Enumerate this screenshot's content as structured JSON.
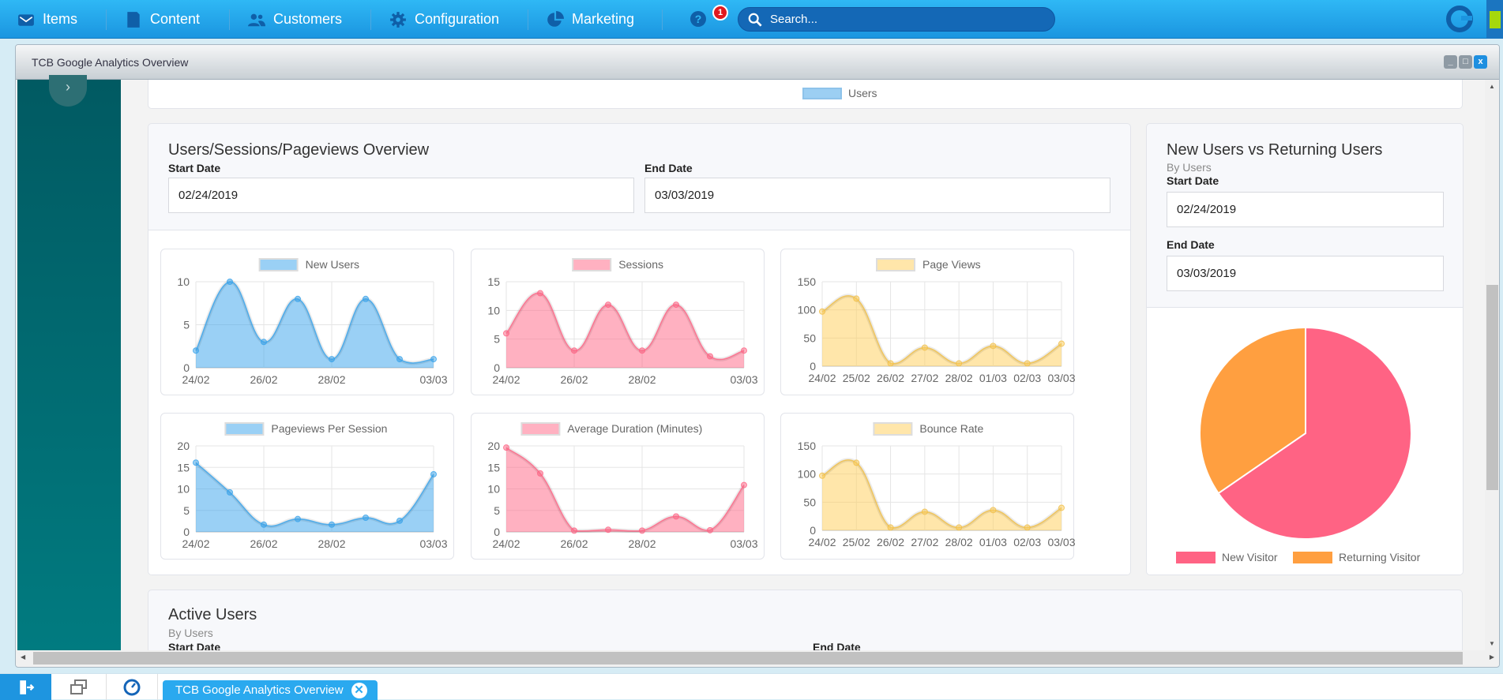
{
  "topnav": {
    "items": [
      {
        "label": "Items",
        "icon": "inbox-icon"
      },
      {
        "label": "Content",
        "icon": "document-icon"
      },
      {
        "label": "Customers",
        "icon": "users-icon"
      },
      {
        "label": "Configuration",
        "icon": "gear-icon"
      },
      {
        "label": "Marketing",
        "icon": "pie-chart-icon"
      }
    ],
    "help_badge": "1",
    "help_icon": "?",
    "search_placeholder": "Search..."
  },
  "window": {
    "title": "TCB Google Analytics Overview",
    "controls": {
      "minimize": "_",
      "maximize": "□",
      "close": "x"
    }
  },
  "users_card": {
    "legend": "Users"
  },
  "overview": {
    "title": "Users/Sessions/Pageviews Overview",
    "start_label": "Start Date",
    "start_value": "02/24/2019",
    "end_label": "End Date",
    "end_value": "03/03/2019"
  },
  "returning": {
    "title": "New Users vs Returning Users",
    "subtitle": "By Users",
    "start_label": "Start Date",
    "start_value": "02/24/2019",
    "end_label": "End Date",
    "end_value": "03/03/2019"
  },
  "active": {
    "title": "Active Users",
    "subtitle": "By Users",
    "start_label": "Start Date",
    "end_label": "End Date"
  },
  "colors": {
    "blue": "#36a2eb",
    "pink": "#ff6384",
    "yellow": "#ffce56",
    "orange": "#ff9f40"
  },
  "chart_data": [
    {
      "type": "area",
      "title": "New Users",
      "color": "blue",
      "categories": [
        "24/02",
        "25/02",
        "26/02",
        "27/02",
        "28/02",
        "01/03",
        "02/03",
        "03/03"
      ],
      "visible_ticks": [
        "24/02",
        "26/02",
        "28/02",
        "03/03"
      ],
      "values": [
        2,
        10,
        3,
        8,
        1,
        8,
        1,
        1
      ],
      "ylim": [
        0,
        10
      ],
      "yticks": [
        0,
        5,
        10
      ]
    },
    {
      "type": "area",
      "title": "Sessions",
      "color": "pink",
      "categories": [
        "24/02",
        "25/02",
        "26/02",
        "27/02",
        "28/02",
        "01/03",
        "02/03",
        "03/03"
      ],
      "visible_ticks": [
        "24/02",
        "26/02",
        "28/02",
        "03/03"
      ],
      "values": [
        6,
        13,
        3,
        11,
        3,
        11,
        2,
        3
      ],
      "ylim": [
        0,
        15
      ],
      "yticks": [
        0,
        5,
        10,
        15
      ]
    },
    {
      "type": "area",
      "title": "Page Views",
      "color": "yellow",
      "categories": [
        "24/02",
        "25/02",
        "26/02",
        "27/02",
        "28/02",
        "01/03",
        "02/03",
        "03/03"
      ],
      "visible_ticks": [
        "24/02",
        "25/02",
        "26/02",
        "27/02",
        "28/02",
        "01/03",
        "02/03",
        "03/03"
      ],
      "values": [
        97,
        120,
        5,
        33,
        5,
        36,
        5,
        40
      ],
      "ylim": [
        0,
        150
      ],
      "yticks": [
        0,
        50,
        100,
        150
      ]
    },
    {
      "type": "area",
      "title": "Pageviews Per Session",
      "color": "blue",
      "categories": [
        "24/02",
        "25/02",
        "26/02",
        "27/02",
        "28/02",
        "01/03",
        "02/03",
        "03/03"
      ],
      "visible_ticks": [
        "24/02",
        "26/02",
        "28/02",
        "03/03"
      ],
      "values": [
        16.1,
        9.2,
        1.7,
        3.0,
        1.7,
        3.3,
        2.6,
        13.4
      ],
      "ylim": [
        0,
        20
      ],
      "yticks": [
        0,
        5,
        10,
        15,
        20
      ]
    },
    {
      "type": "area",
      "title": "Average Duration (Minutes)",
      "color": "pink",
      "categories": [
        "24/02",
        "25/02",
        "26/02",
        "27/02",
        "28/02",
        "01/03",
        "02/03",
        "03/03"
      ],
      "visible_ticks": [
        "24/02",
        "26/02",
        "28/02",
        "03/03"
      ],
      "values": [
        19.6,
        13.6,
        0.3,
        0.5,
        0.3,
        3.6,
        0.4,
        10.9
      ],
      "ylim": [
        0,
        20
      ],
      "yticks": [
        0,
        5,
        10,
        15,
        20
      ]
    },
    {
      "type": "area",
      "title": "Bounce Rate",
      "color": "yellow",
      "categories": [
        "24/02",
        "25/02",
        "26/02",
        "27/02",
        "28/02",
        "01/03",
        "02/03",
        "03/03"
      ],
      "visible_ticks": [
        "24/02",
        "25/02",
        "26/02",
        "27/02",
        "28/02",
        "01/03",
        "02/03",
        "03/03"
      ],
      "values": [
        97,
        120,
        5,
        33,
        5,
        36,
        5,
        40
      ],
      "ylim": [
        0,
        150
      ],
      "yticks": [
        0,
        50,
        100,
        150
      ]
    },
    {
      "type": "pie",
      "categories": [
        "New Visitor",
        "Returning Visitor"
      ],
      "values": [
        65.4,
        34.6
      ],
      "colors": [
        "pink",
        "orange"
      ],
      "legend": "bottom"
    }
  ],
  "taskbar": {
    "tab_label": "TCB Google Analytics Overview",
    "icons": [
      "logout-icon",
      "windows-icon",
      "dashboard-icon"
    ]
  }
}
